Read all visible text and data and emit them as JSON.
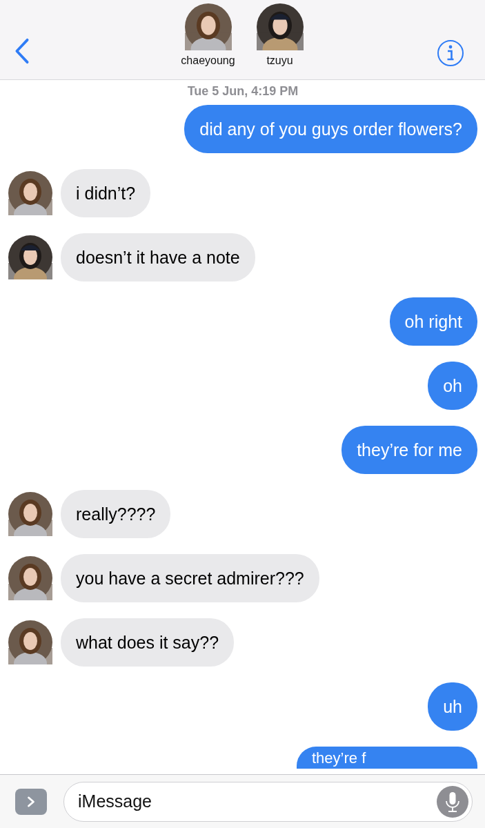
{
  "header": {
    "participants": [
      {
        "name": "chaeyoung",
        "kind": "picture"
      },
      {
        "name": "tzuyu",
        "kind": "picture"
      }
    ]
  },
  "timestamp": "Tue 5 Jun, 4:19 PM",
  "messages": [
    {
      "kind": "sent",
      "text": "did any of you guys order flowers?"
    },
    {
      "kind": "received",
      "text": "i didn’t?"
    },
    {
      "kind": "received",
      "text": "doesn’t it have a note"
    },
    {
      "kind": "sent",
      "text": "oh right"
    },
    {
      "kind": "sent",
      "text": "oh"
    },
    {
      "kind": "sent",
      "text": "they’re for me"
    },
    {
      "kind": "received",
      "text": "really????"
    },
    {
      "kind": "received",
      "text": "you have a secret admirer???"
    },
    {
      "kind": "received",
      "text": "what does it say??"
    },
    {
      "kind": "sent",
      "text": "uh"
    },
    {
      "kind": "cut",
      "text": "they’re f"
    }
  ],
  "composer": {
    "placeholder": "iMessage"
  }
}
